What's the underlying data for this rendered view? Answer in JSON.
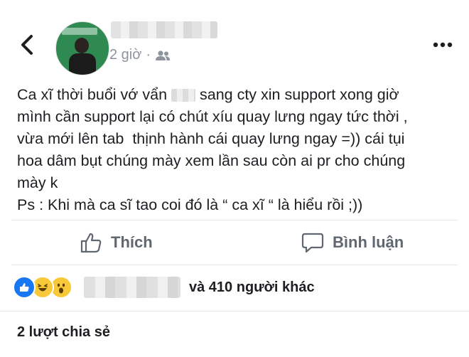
{
  "post": {
    "time": "2 giờ",
    "separator": "·",
    "audience_icon": "friends-icon",
    "text_part1": "Ca xĩ thời buổi vớ vẩn ",
    "text_part2": " sang cty xin support xong giờ\nmình cần support lại có chút xíu quay lưng ngay tức thời ,\nvừa mới lên tab  thịnh hành cái quay lưng ngay =)) cái tụi\nhoa dâm bụt chúng mày xem lần sau còn ai pr cho chúng\nmày k\nPs : Khi mà ca sĩ tao coi đó là “ ca xĩ “ là hiểu rồi ;))"
  },
  "actions": {
    "like_label": "Thích",
    "comment_label": "Bình luận"
  },
  "reactions": {
    "types": [
      "like",
      "haha",
      "wow"
    ],
    "others_text": "và 410 người khác"
  },
  "shares": {
    "label": "2 lượt chia sẻ"
  },
  "colors": {
    "accent": "#1877f2",
    "secondary_text": "#606770",
    "muted_text": "#8d949e"
  }
}
